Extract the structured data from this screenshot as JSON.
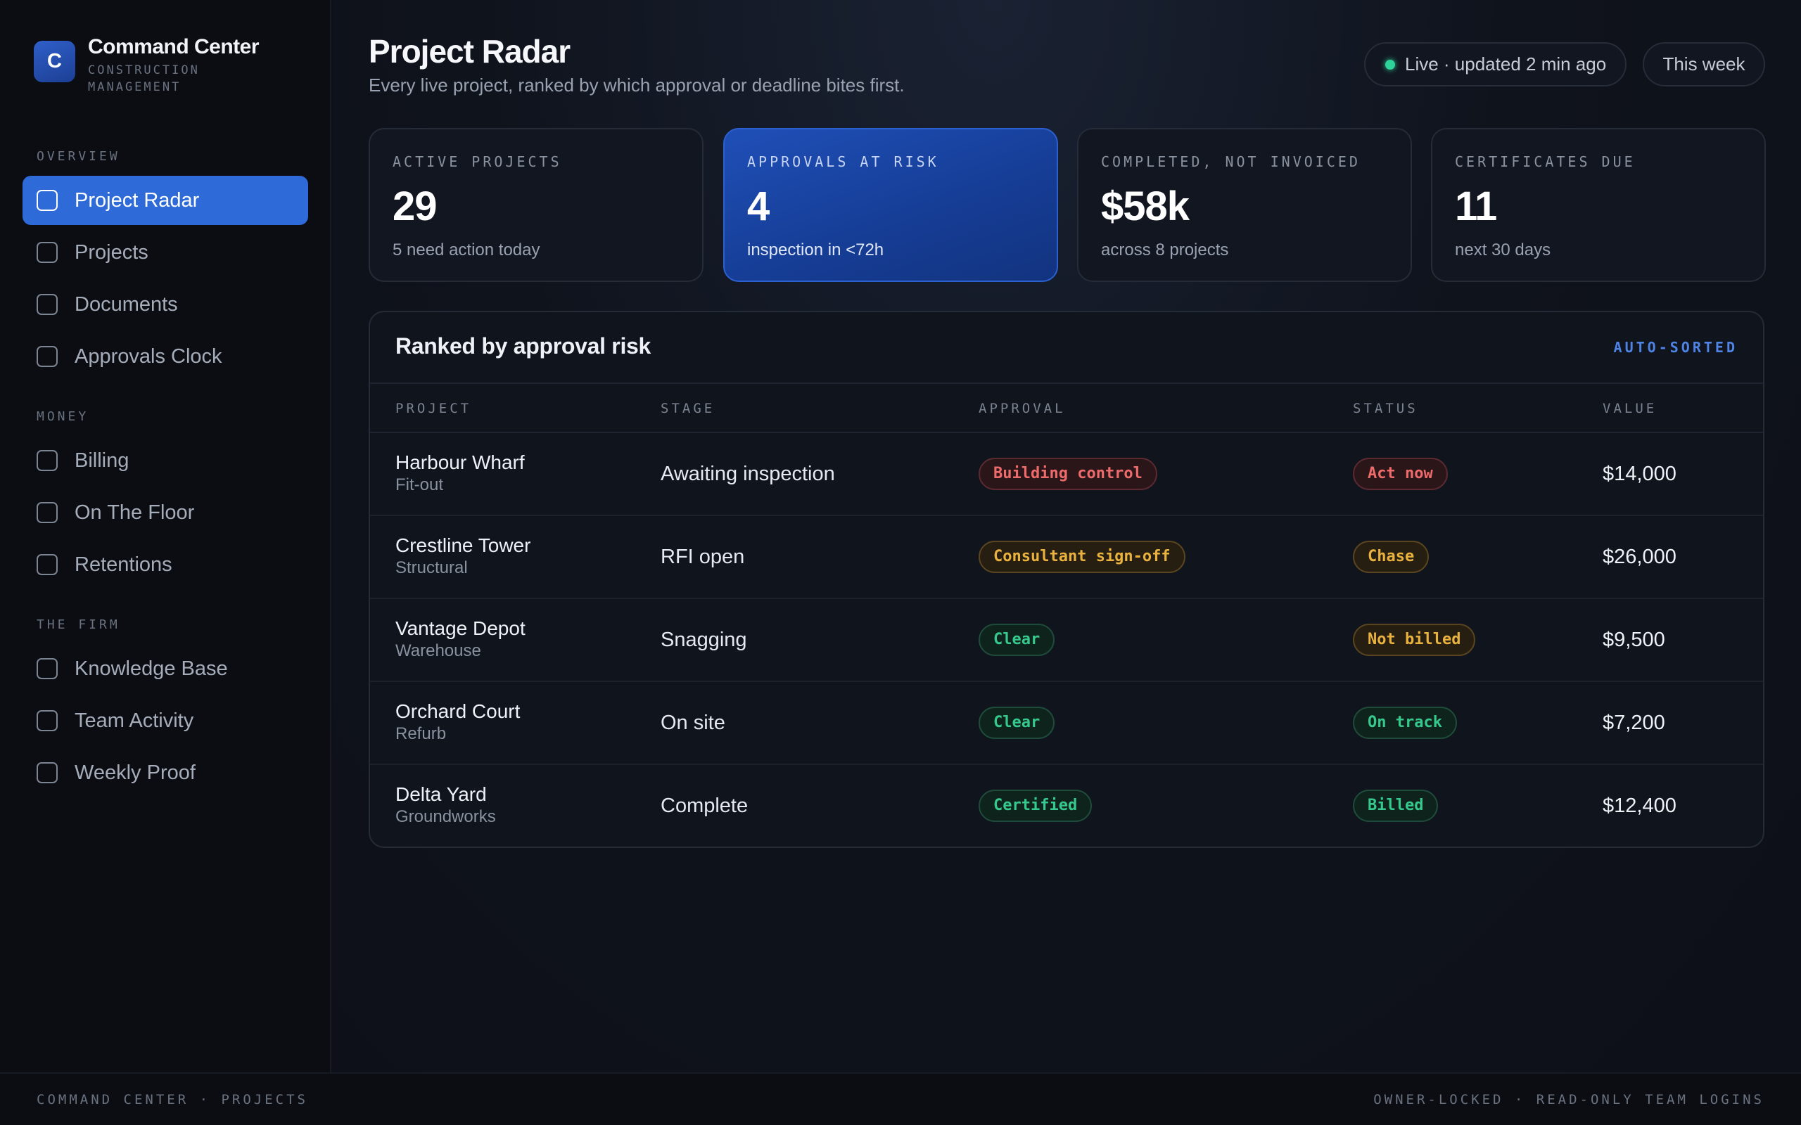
{
  "brand": {
    "logo_letter": "C",
    "title": "Command Center",
    "subtitle": "CONSTRUCTION MANAGEMENT"
  },
  "sidebar": {
    "sections": [
      {
        "heading": "OVERVIEW",
        "items": [
          {
            "label": "Project Radar",
            "active": true
          },
          {
            "label": "Projects"
          },
          {
            "label": "Documents"
          },
          {
            "label": "Approvals Clock"
          }
        ]
      },
      {
        "heading": "MONEY",
        "items": [
          {
            "label": "Billing"
          },
          {
            "label": "On The Floor"
          },
          {
            "label": "Retentions"
          }
        ]
      },
      {
        "heading": "THE FIRM",
        "items": [
          {
            "label": "Knowledge Base"
          },
          {
            "label": "Team Activity"
          },
          {
            "label": "Weekly Proof"
          }
        ]
      }
    ]
  },
  "header": {
    "title": "Project Radar",
    "subtitle": "Every live project, ranked by which approval or deadline bites first.",
    "live_status": "Live · updated 2 min ago",
    "period": "This week"
  },
  "stats": [
    {
      "label": "ACTIVE PROJECTS",
      "value": "29",
      "note": "5 need action today",
      "highlight": false
    },
    {
      "label": "APPROVALS AT RISK",
      "value": "4",
      "note": "inspection in <72h",
      "highlight": true
    },
    {
      "label": "COMPLETED, NOT INVOICED",
      "value": "$58k",
      "note": "across 8 projects",
      "highlight": false
    },
    {
      "label": "CERTIFICATES DUE",
      "value": "11",
      "note": "next 30 days",
      "highlight": false
    }
  ],
  "table": {
    "title": "Ranked by approval risk",
    "tag": "AUTO-SORTED",
    "columns": [
      "PROJECT",
      "STAGE",
      "APPROVAL",
      "STATUS",
      "VALUE"
    ],
    "rows": [
      {
        "name": "Harbour Wharf",
        "type": "Fit-out",
        "stage": "Awaiting inspection",
        "approval": "Building control",
        "approval_tone": "red",
        "status": "Act now",
        "status_tone": "red",
        "value": "$14,000"
      },
      {
        "name": "Crestline Tower",
        "type": "Structural",
        "stage": "RFI open",
        "approval": "Consultant sign-off",
        "approval_tone": "amber",
        "status": "Chase",
        "status_tone": "amber",
        "value": "$26,000"
      },
      {
        "name": "Vantage Depot",
        "type": "Warehouse",
        "stage": "Snagging",
        "approval": "Clear",
        "approval_tone": "green",
        "status": "Not billed",
        "status_tone": "amber",
        "value": "$9,500"
      },
      {
        "name": "Orchard Court",
        "type": "Refurb",
        "stage": "On site",
        "approval": "Clear",
        "approval_tone": "green",
        "status": "On track",
        "status_tone": "green",
        "value": "$7,200"
      },
      {
        "name": "Delta Yard",
        "type": "Groundworks",
        "stage": "Complete",
        "approval": "Certified",
        "approval_tone": "green",
        "status": "Billed",
        "status_tone": "green",
        "value": "$12,400"
      }
    ]
  },
  "footer": {
    "left": "COMMAND CENTER · PROJECTS",
    "right": "OWNER-LOCKED · READ-ONLY TEAM LOGINS"
  },
  "colors": {
    "accent": "#2e6ad8",
    "live": "#2ed39a",
    "red": "#ee6b6b",
    "amber": "#e9b23f",
    "green": "#36c98d"
  }
}
